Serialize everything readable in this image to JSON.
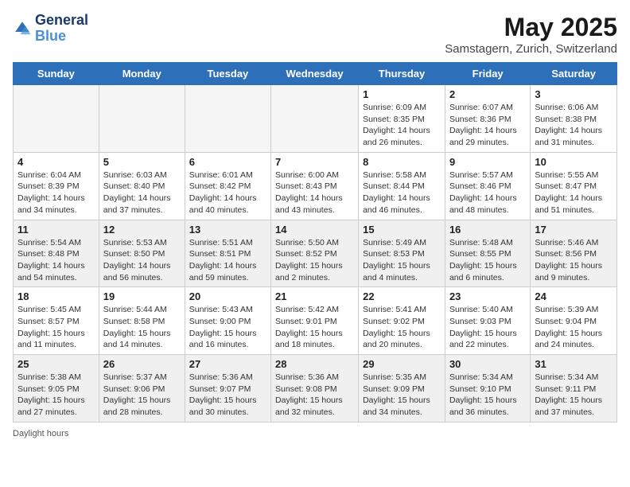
{
  "logo": {
    "line1": "General",
    "line2": "Blue"
  },
  "title": "May 2025",
  "subtitle": "Samstagern, Zurich, Switzerland",
  "headers": [
    "Sunday",
    "Monday",
    "Tuesday",
    "Wednesday",
    "Thursday",
    "Friday",
    "Saturday"
  ],
  "weeks": [
    [
      {
        "day": "",
        "info": "",
        "empty": true
      },
      {
        "day": "",
        "info": "",
        "empty": true
      },
      {
        "day": "",
        "info": "",
        "empty": true
      },
      {
        "day": "",
        "info": "",
        "empty": true
      },
      {
        "day": "1",
        "info": "Sunrise: 6:09 AM\nSunset: 8:35 PM\nDaylight: 14 hours\nand 26 minutes."
      },
      {
        "day": "2",
        "info": "Sunrise: 6:07 AM\nSunset: 8:36 PM\nDaylight: 14 hours\nand 29 minutes."
      },
      {
        "day": "3",
        "info": "Sunrise: 6:06 AM\nSunset: 8:38 PM\nDaylight: 14 hours\nand 31 minutes."
      }
    ],
    [
      {
        "day": "4",
        "info": "Sunrise: 6:04 AM\nSunset: 8:39 PM\nDaylight: 14 hours\nand 34 minutes."
      },
      {
        "day": "5",
        "info": "Sunrise: 6:03 AM\nSunset: 8:40 PM\nDaylight: 14 hours\nand 37 minutes."
      },
      {
        "day": "6",
        "info": "Sunrise: 6:01 AM\nSunset: 8:42 PM\nDaylight: 14 hours\nand 40 minutes."
      },
      {
        "day": "7",
        "info": "Sunrise: 6:00 AM\nSunset: 8:43 PM\nDaylight: 14 hours\nand 43 minutes."
      },
      {
        "day": "8",
        "info": "Sunrise: 5:58 AM\nSunset: 8:44 PM\nDaylight: 14 hours\nand 46 minutes."
      },
      {
        "day": "9",
        "info": "Sunrise: 5:57 AM\nSunset: 8:46 PM\nDaylight: 14 hours\nand 48 minutes."
      },
      {
        "day": "10",
        "info": "Sunrise: 5:55 AM\nSunset: 8:47 PM\nDaylight: 14 hours\nand 51 minutes."
      }
    ],
    [
      {
        "day": "11",
        "info": "Sunrise: 5:54 AM\nSunset: 8:48 PM\nDaylight: 14 hours\nand 54 minutes.",
        "shaded": true
      },
      {
        "day": "12",
        "info": "Sunrise: 5:53 AM\nSunset: 8:50 PM\nDaylight: 14 hours\nand 56 minutes.",
        "shaded": true
      },
      {
        "day": "13",
        "info": "Sunrise: 5:51 AM\nSunset: 8:51 PM\nDaylight: 14 hours\nand 59 minutes.",
        "shaded": true
      },
      {
        "day": "14",
        "info": "Sunrise: 5:50 AM\nSunset: 8:52 PM\nDaylight: 15 hours\nand 2 minutes.",
        "shaded": true
      },
      {
        "day": "15",
        "info": "Sunrise: 5:49 AM\nSunset: 8:53 PM\nDaylight: 15 hours\nand 4 minutes.",
        "shaded": true
      },
      {
        "day": "16",
        "info": "Sunrise: 5:48 AM\nSunset: 8:55 PM\nDaylight: 15 hours\nand 6 minutes.",
        "shaded": true
      },
      {
        "day": "17",
        "info": "Sunrise: 5:46 AM\nSunset: 8:56 PM\nDaylight: 15 hours\nand 9 minutes.",
        "shaded": true
      }
    ],
    [
      {
        "day": "18",
        "info": "Sunrise: 5:45 AM\nSunset: 8:57 PM\nDaylight: 15 hours\nand 11 minutes."
      },
      {
        "day": "19",
        "info": "Sunrise: 5:44 AM\nSunset: 8:58 PM\nDaylight: 15 hours\nand 14 minutes."
      },
      {
        "day": "20",
        "info": "Sunrise: 5:43 AM\nSunset: 9:00 PM\nDaylight: 15 hours\nand 16 minutes."
      },
      {
        "day": "21",
        "info": "Sunrise: 5:42 AM\nSunset: 9:01 PM\nDaylight: 15 hours\nand 18 minutes."
      },
      {
        "day": "22",
        "info": "Sunrise: 5:41 AM\nSunset: 9:02 PM\nDaylight: 15 hours\nand 20 minutes."
      },
      {
        "day": "23",
        "info": "Sunrise: 5:40 AM\nSunset: 9:03 PM\nDaylight: 15 hours\nand 22 minutes."
      },
      {
        "day": "24",
        "info": "Sunrise: 5:39 AM\nSunset: 9:04 PM\nDaylight: 15 hours\nand 24 minutes."
      }
    ],
    [
      {
        "day": "25",
        "info": "Sunrise: 5:38 AM\nSunset: 9:05 PM\nDaylight: 15 hours\nand 27 minutes.",
        "shaded": true
      },
      {
        "day": "26",
        "info": "Sunrise: 5:37 AM\nSunset: 9:06 PM\nDaylight: 15 hours\nand 28 minutes.",
        "shaded": true
      },
      {
        "day": "27",
        "info": "Sunrise: 5:36 AM\nSunset: 9:07 PM\nDaylight: 15 hours\nand 30 minutes.",
        "shaded": true
      },
      {
        "day": "28",
        "info": "Sunrise: 5:36 AM\nSunset: 9:08 PM\nDaylight: 15 hours\nand 32 minutes.",
        "shaded": true
      },
      {
        "day": "29",
        "info": "Sunrise: 5:35 AM\nSunset: 9:09 PM\nDaylight: 15 hours\nand 34 minutes.",
        "shaded": true
      },
      {
        "day": "30",
        "info": "Sunrise: 5:34 AM\nSunset: 9:10 PM\nDaylight: 15 hours\nand 36 minutes.",
        "shaded": true
      },
      {
        "day": "31",
        "info": "Sunrise: 5:34 AM\nSunset: 9:11 PM\nDaylight: 15 hours\nand 37 minutes.",
        "shaded": true
      }
    ]
  ],
  "footer": "Daylight hours"
}
